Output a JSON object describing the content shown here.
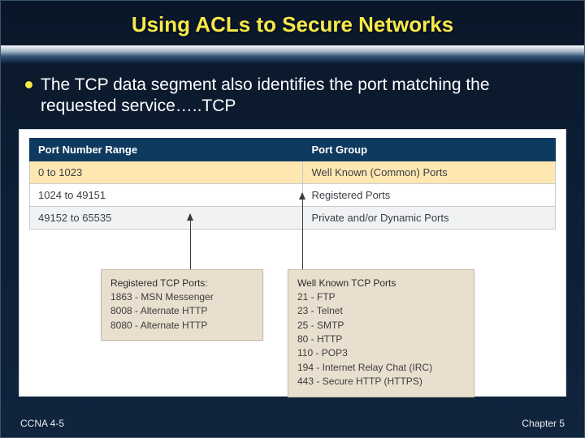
{
  "title": "Using ACLs to Secure Networks",
  "bullet": "The TCP data segment also identifies the port matching the requested service…..TCP",
  "table": {
    "headers": {
      "range": "Port Number Range",
      "group": "Port Group"
    },
    "rows": [
      {
        "range": "0 to 1023",
        "group": "Well Known (Common) Ports"
      },
      {
        "range": "1024 to 49151",
        "group": "Registered Ports"
      },
      {
        "range": "49152 to 65535",
        "group": "Private and/or Dynamic Ports"
      }
    ]
  },
  "callouts": {
    "registered": {
      "title": "Registered TCP Ports:",
      "lines": [
        "1863 - MSN Messenger",
        "8008 - Alternate HTTP",
        "8080 - Alternate HTTP"
      ]
    },
    "wellknown": {
      "title": "Well Known TCP Ports",
      "lines": [
        "21 - FTP",
        "23 - Telnet",
        "25 - SMTP",
        "80 - HTTP",
        "110 - POP3",
        "194 - Internet Relay Chat (IRC)",
        "443 - Secure HTTP (HTTPS)"
      ]
    }
  },
  "footer": {
    "left": "CCNA 4-5",
    "right": "Chapter 5"
  },
  "chart_data": {
    "type": "table",
    "title": "TCP Port Number Ranges and Groups",
    "columns": [
      "Port Number Range",
      "Port Group"
    ],
    "rows": [
      [
        "0 to 1023",
        "Well Known (Common) Ports"
      ],
      [
        "1024 to 49151",
        "Registered Ports"
      ],
      [
        "49152 to 65535",
        "Private and/or Dynamic Ports"
      ]
    ],
    "annotations": {
      "Registered TCP Ports": {
        "1863": "MSN Messenger",
        "8008": "Alternate HTTP",
        "8080": "Alternate HTTP"
      },
      "Well Known TCP Ports": {
        "21": "FTP",
        "23": "Telnet",
        "25": "SMTP",
        "80": "HTTP",
        "110": "POP3",
        "194": "Internet Relay Chat (IRC)",
        "443": "Secure HTTP (HTTPS)"
      }
    }
  }
}
